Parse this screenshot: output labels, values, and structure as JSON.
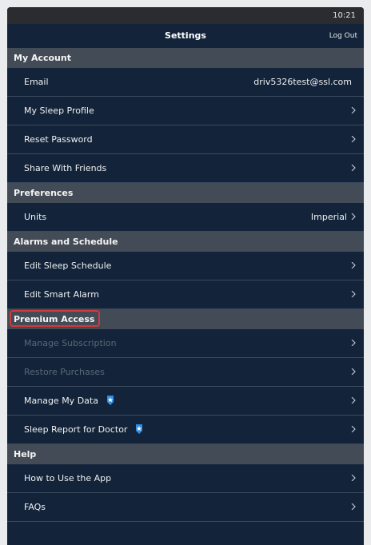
{
  "status_bar": {
    "time": "10:21"
  },
  "nav": {
    "title": "Settings",
    "logout_label": "Log Out"
  },
  "sections": {
    "my_account": {
      "header": "My Account",
      "email_label": "Email",
      "email_value": "driv5326test@ssl.com",
      "sleep_profile": "My Sleep Profile",
      "reset_password": "Reset Password",
      "share_friends": "Share With Friends"
    },
    "preferences": {
      "header": "Preferences",
      "units_label": "Units",
      "units_value": "Imperial"
    },
    "alarms": {
      "header": "Alarms and Schedule",
      "edit_schedule": "Edit Sleep Schedule",
      "edit_alarm": "Edit Smart Alarm"
    },
    "premium": {
      "header": "Premium Access",
      "manage_subscription": "Manage Subscription",
      "restore_purchases": "Restore Purchases",
      "manage_data": "Manage My Data",
      "sleep_report": "Sleep Report for Doctor"
    },
    "help": {
      "header": "Help",
      "how_to_use": "How to Use the App",
      "faqs": "FAQs"
    }
  },
  "colors": {
    "background": "#13243a",
    "section_header": "#434b56",
    "highlight": "#d23a3a",
    "premium_badge": "#2f8fe6"
  },
  "icons": {
    "chevron": "chevron-right-icon",
    "premium_badge": "premium-star-badge-icon"
  }
}
